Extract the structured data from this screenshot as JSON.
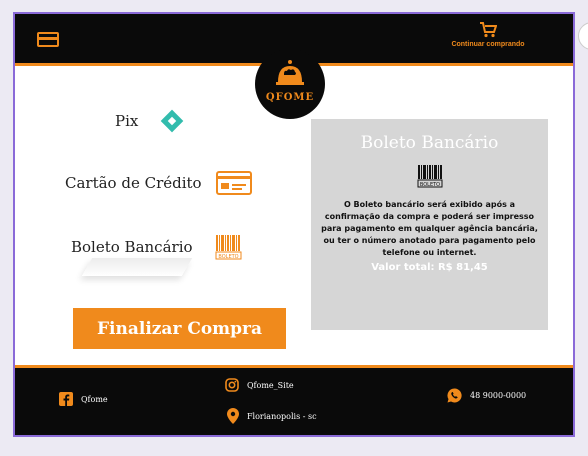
{
  "header": {
    "cart_label": "Continuar comprando",
    "logo_text": "QFOME"
  },
  "payment_methods": [
    {
      "label": "Pix",
      "icon": "pix-icon"
    },
    {
      "label": "Cartão de Crédito",
      "icon": "credit-card-icon"
    },
    {
      "label": "Boleto Bancário",
      "icon": "boleto-barcode-icon",
      "icon_text": "BOLETO"
    }
  ],
  "finalize_label": "Finalizar Compra",
  "panel": {
    "title": "Boleto Bancário",
    "barcode_text": "BOLETO",
    "description": "O Boleto bancário será exibido após a confirmação da compra e poderá ser impresso para pagamento em qualquer agência bancária, ou ter o número anotado para pagamento pelo telefone ou internet.",
    "total": "Valor total: R$ 81,45"
  },
  "footer": {
    "facebook": "Qfome",
    "instagram": "Qfome_Site",
    "location": "Florianopolis - sc",
    "phone": "48 9000-0000"
  },
  "colors": {
    "accent": "#f08a1c",
    "dark": "#0a0a0a",
    "panel": "#d6d6d6",
    "pix": "#32bcad"
  }
}
